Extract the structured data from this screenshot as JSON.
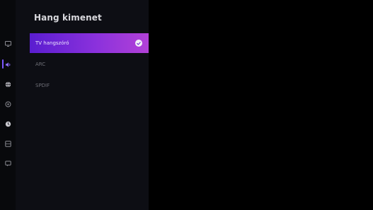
{
  "panel": {
    "title": "Hang kimenet",
    "options": [
      {
        "label": "TV hangszóró",
        "selected": true,
        "icon": "check-circle-icon"
      },
      {
        "label": "ARC",
        "selected": false
      },
      {
        "label": "SPDIF",
        "selected": false
      }
    ]
  },
  "rail": {
    "items": [
      {
        "icon": "picture-icon"
      },
      {
        "icon": "sound-icon",
        "active": true
      },
      {
        "icon": "network-icon"
      },
      {
        "icon": "channel-icon"
      },
      {
        "icon": "general-icon"
      },
      {
        "icon": "apps-icon"
      },
      {
        "icon": "support-icon"
      }
    ]
  },
  "colors": {
    "accent_start": "#5a1dd0",
    "accent_end": "#b241d8",
    "background": "#000000",
    "panel_background": "#0d0e14",
    "rail_background": "#08090c"
  }
}
